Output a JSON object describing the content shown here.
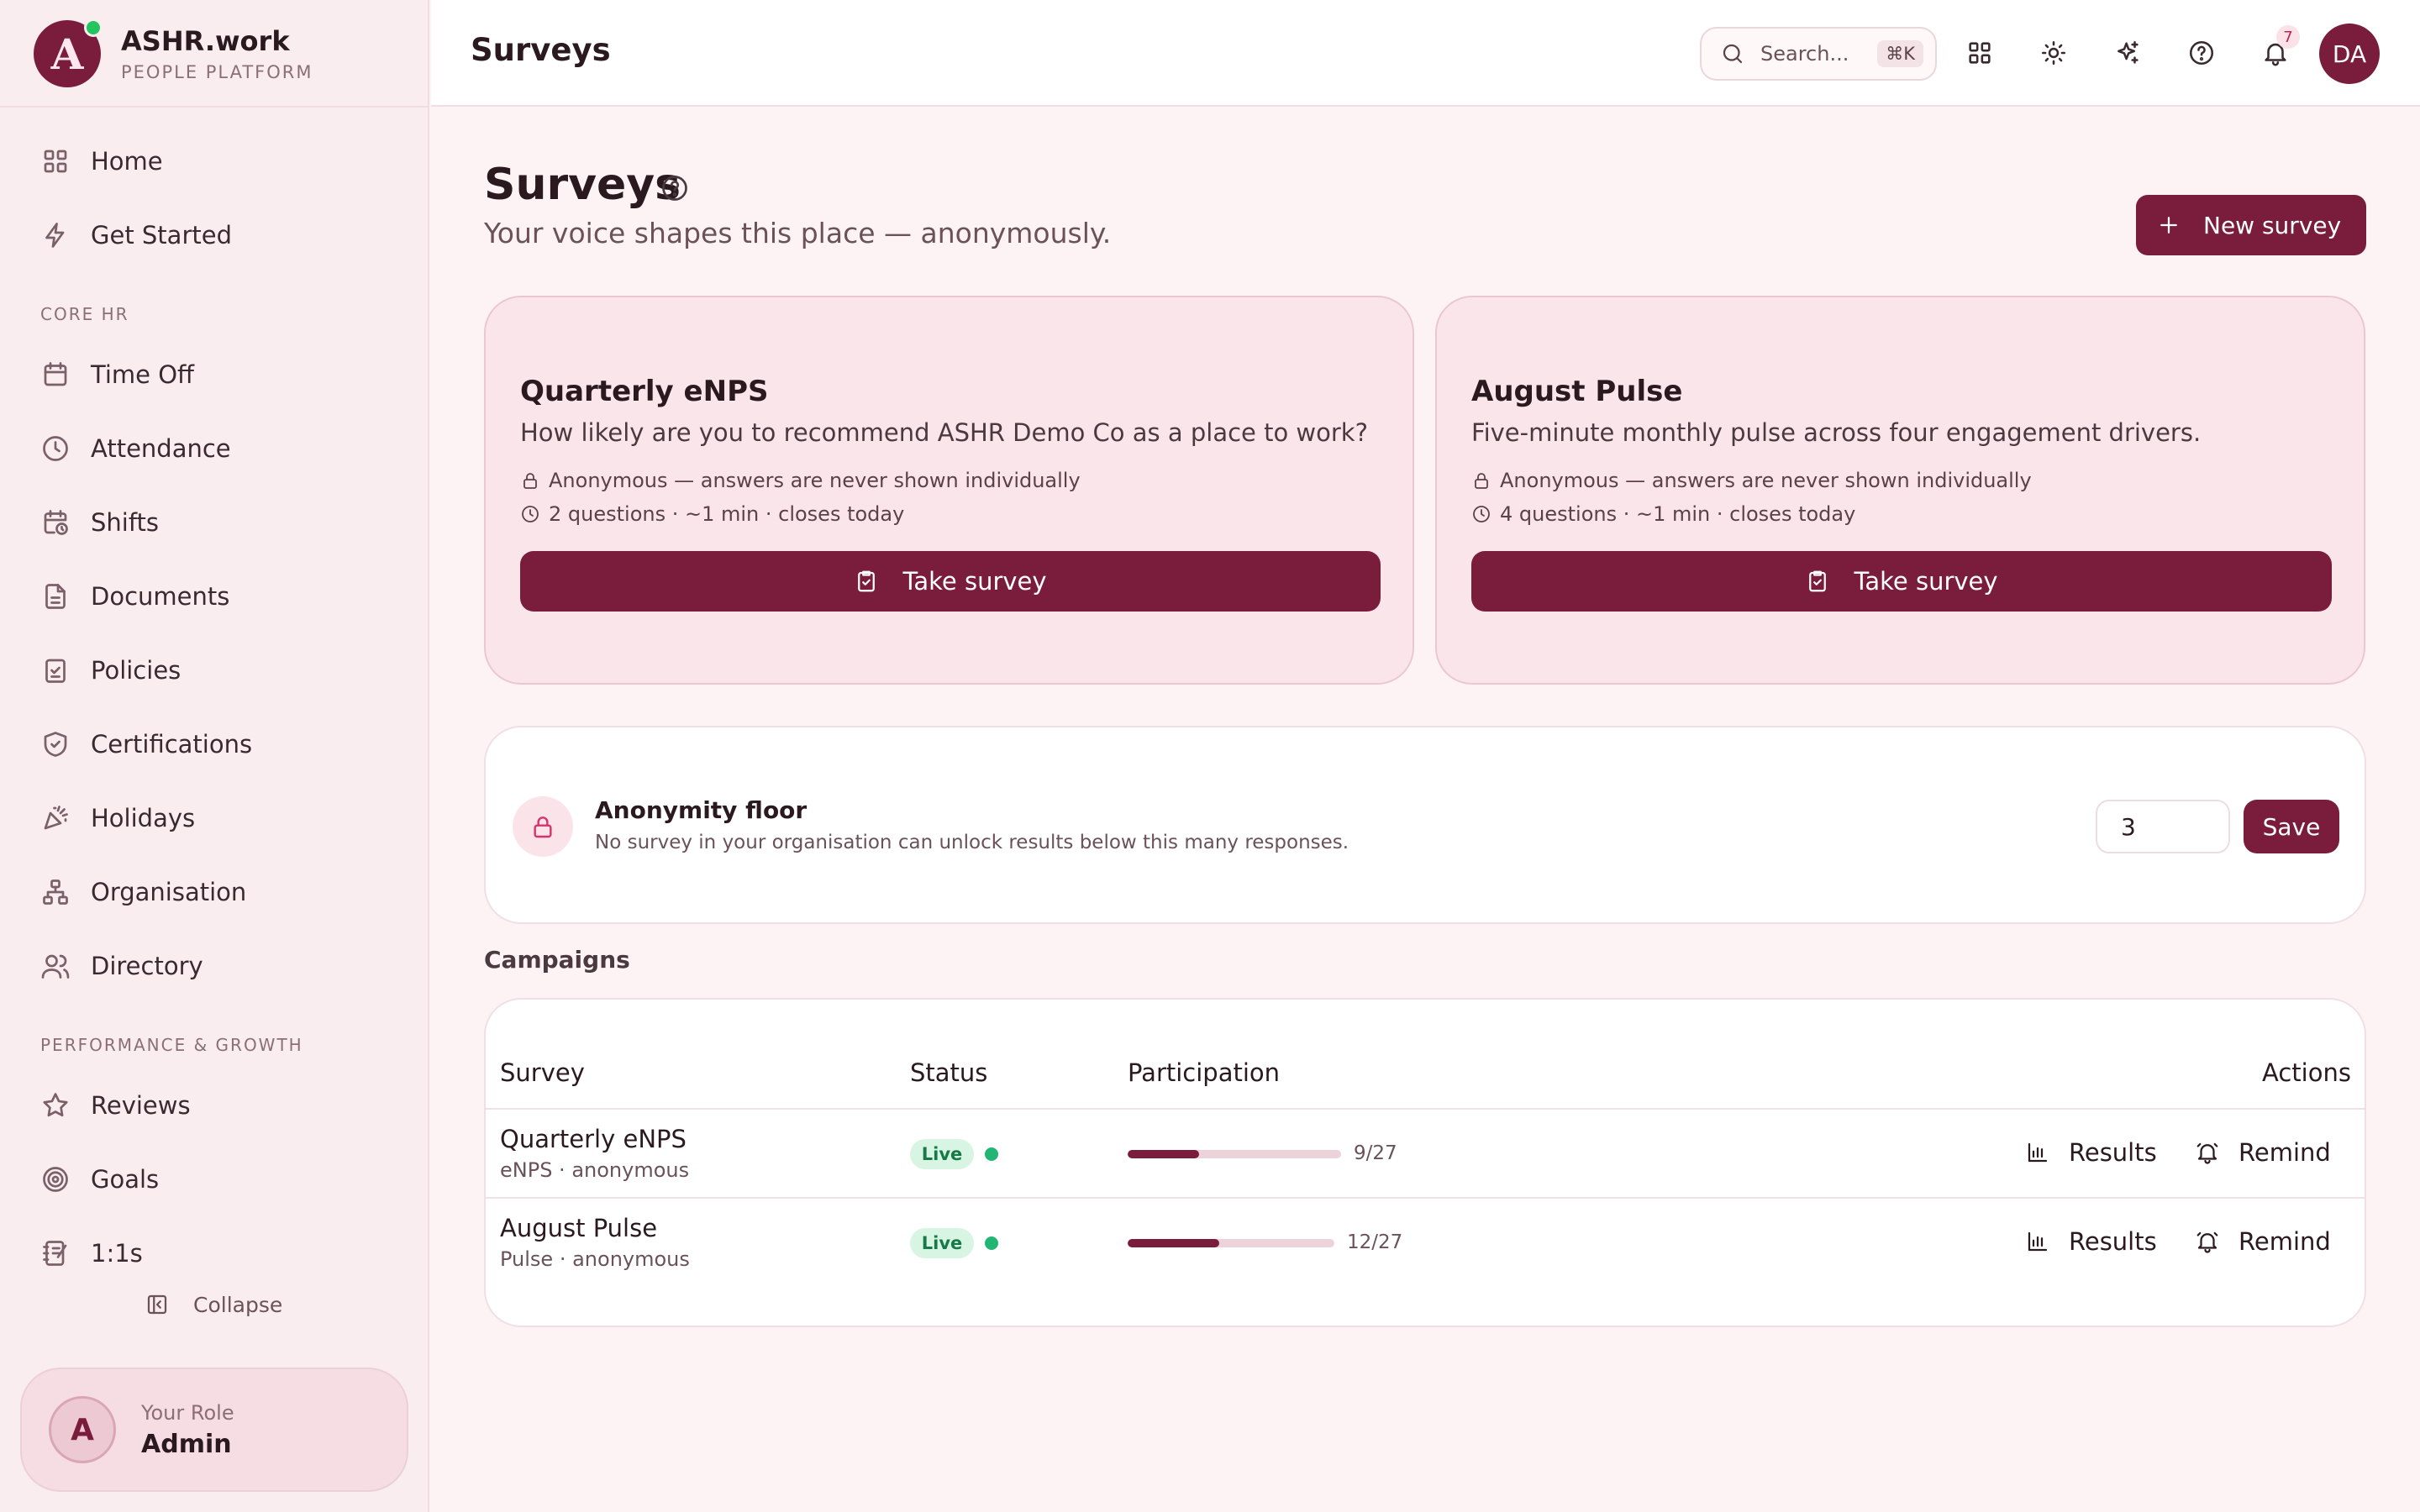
{
  "brand": {
    "initial": "A",
    "name": "ASHR.work",
    "subtitle": "PEOPLE PLATFORM"
  },
  "sidebar": {
    "items_top": [
      {
        "label": "Home",
        "icon": "grid-icon"
      },
      {
        "label": "Get Started",
        "icon": "bolt-icon"
      }
    ],
    "section_core": "CORE HR",
    "items_core": [
      {
        "label": "Time Off",
        "icon": "calendar-icon"
      },
      {
        "label": "Attendance",
        "icon": "clock-icon"
      },
      {
        "label": "Shifts",
        "icon": "calendar-clock-icon"
      },
      {
        "label": "Documents",
        "icon": "document-icon"
      },
      {
        "label": "Policies",
        "icon": "clipboard-check-icon"
      },
      {
        "label": "Certifications",
        "icon": "shield-check-icon"
      },
      {
        "label": "Holidays",
        "icon": "party-icon"
      },
      {
        "label": "Organisation",
        "icon": "org-chart-icon"
      },
      {
        "label": "Directory",
        "icon": "users-icon"
      }
    ],
    "section_perf": "PERFORMANCE & GROWTH",
    "items_perf": [
      {
        "label": "Reviews",
        "icon": "star-icon"
      },
      {
        "label": "Goals",
        "icon": "target-icon"
      },
      {
        "label": "1:1s",
        "icon": "notebook-icon"
      }
    ],
    "collapse_label": "Collapse",
    "role": {
      "initial": "A",
      "label": "Your Role",
      "value": "Admin"
    }
  },
  "topbar": {
    "title": "Surveys",
    "search_placeholder": "Search...",
    "search_shortcut": "⌘K",
    "notification_count": "7",
    "avatar_initials": "DA"
  },
  "page": {
    "title": "Surveys",
    "subtitle": "Your voice shapes this place — anonymously.",
    "new_survey_label": "New survey"
  },
  "survey_cards": [
    {
      "title": "Quarterly eNPS",
      "description": "How likely are you to recommend ASHR Demo Co as a place to work?",
      "anonymity": "Anonymous — answers are never shown individually",
      "meta": "2 questions · ~1 min · closes today",
      "button": "Take survey"
    },
    {
      "title": "August Pulse",
      "description": "Five-minute monthly pulse across four engagement drivers.",
      "anonymity": "Anonymous — answers are never shown individually",
      "meta": "4 questions · ~1 min · closes today",
      "button": "Take survey"
    }
  ],
  "anonymity_floor": {
    "title": "Anonymity floor",
    "description": "No survey in your organisation can unlock results below this many responses.",
    "value": "3",
    "save_label": "Save"
  },
  "campaigns": {
    "label": "Campaigns",
    "headers": {
      "survey": "Survey",
      "status": "Status",
      "participation": "Participation",
      "actions": "Actions"
    },
    "rows": [
      {
        "title": "Quarterly eNPS",
        "subtitle": "eNPS · anonymous",
        "status": "Live",
        "participation_text": "9/27",
        "participation_fraction": 0.333,
        "results_label": "Results",
        "remind_label": "Remind"
      },
      {
        "title": "August Pulse",
        "subtitle": "Pulse · anonymous",
        "status": "Live",
        "participation_text": "12/27",
        "participation_fraction": 0.444,
        "results_label": "Results",
        "remind_label": "Remind"
      }
    ]
  },
  "colors": {
    "brand": "#7a1c3c",
    "live": "#22b573",
    "background": "#fdf3f4"
  }
}
